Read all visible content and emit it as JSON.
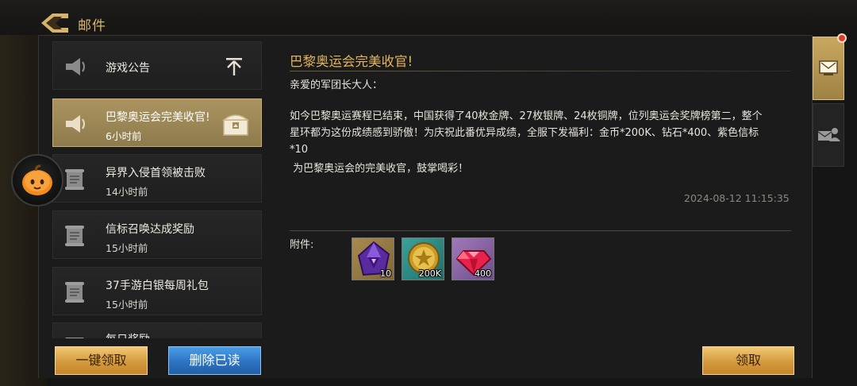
{
  "header": {
    "title": "邮件"
  },
  "mails": [
    {
      "title": "游戏公告",
      "time": "",
      "icon": "megaphone-icon",
      "badge": "pin-icon"
    },
    {
      "title": "巴黎奥运会完美收官!",
      "time": "6小时前",
      "icon": "megaphone-icon",
      "badge": "chest-icon"
    },
    {
      "title": "异界入侵首领被击败",
      "time": "14小时前",
      "icon": "scroll-icon"
    },
    {
      "title": "信标召唤达成奖励",
      "time": "15小时前",
      "icon": "scroll-icon"
    },
    {
      "title": "37手游白银每周礼包",
      "time": "15小时前",
      "icon": "scroll-icon"
    },
    {
      "title": "每日奖励",
      "time": "",
      "icon": "scroll-icon"
    }
  ],
  "detail": {
    "title": "巴黎奥运会完美收官!",
    "greeting": "亲爱的军团长大人：",
    "body_lines": [
      "如今巴黎奥运赛程已结束，中国获得了40枚金牌、27枚银牌、24枚铜牌，位列奥运会奖牌榜第二，整个",
      "星环都为这份成绩感到骄傲！为庆祝此番优异成绩，全服下发福利：金币*200K、钻石*400、紫色信标",
      "*10"
    ],
    "signoff": " 为巴黎奥运会的完美收官，鼓掌喝彩！",
    "timestamp": "2024-08-12 11:15:35",
    "attach_label": "附件:",
    "attachments": [
      {
        "name": "purple-beacon",
        "qty": "10"
      },
      {
        "name": "gold-coin",
        "qty": "200K"
      },
      {
        "name": "diamond",
        "qty": "400"
      }
    ]
  },
  "buttons": {
    "claim_all": "一键领取",
    "delete_read": "删除已读",
    "claim": "领取"
  },
  "colors": {
    "accent_gold": "#e2b45c",
    "active_item": "#ab9460",
    "button_blue": "#2d73c2"
  }
}
